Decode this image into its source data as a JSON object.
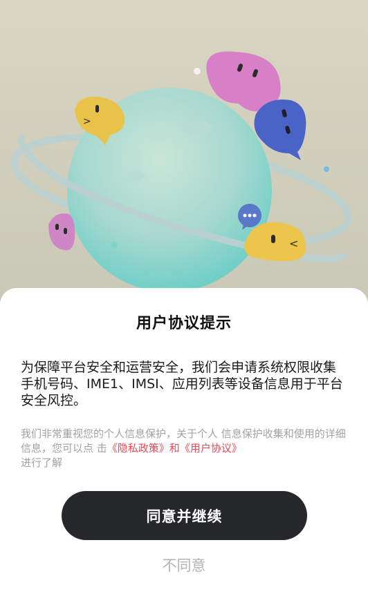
{
  "dialog": {
    "title": "用户协议提示",
    "main_text": "为保障平台安全和运营安全，我们会申请系统权限收集手机号码、IME1、IMSI、应用列表等设备信息用于平台安全风控。",
    "sub_text_prefix": "我们非常重视您的个人信息保护，关于个人 信息保护收集和使用的详细信息，您可以点 击",
    "privacy_link": "《隐私政策》",
    "and_text": "和",
    "agreement_link": "《用户协议》",
    "sub_text_suffix": "进行了解",
    "agree_button": "同意并继续",
    "disagree_button": "不同意"
  },
  "colors": {
    "link": "#e84a56",
    "button_bg": "#26272b",
    "disagree": "#b3b3b3"
  }
}
